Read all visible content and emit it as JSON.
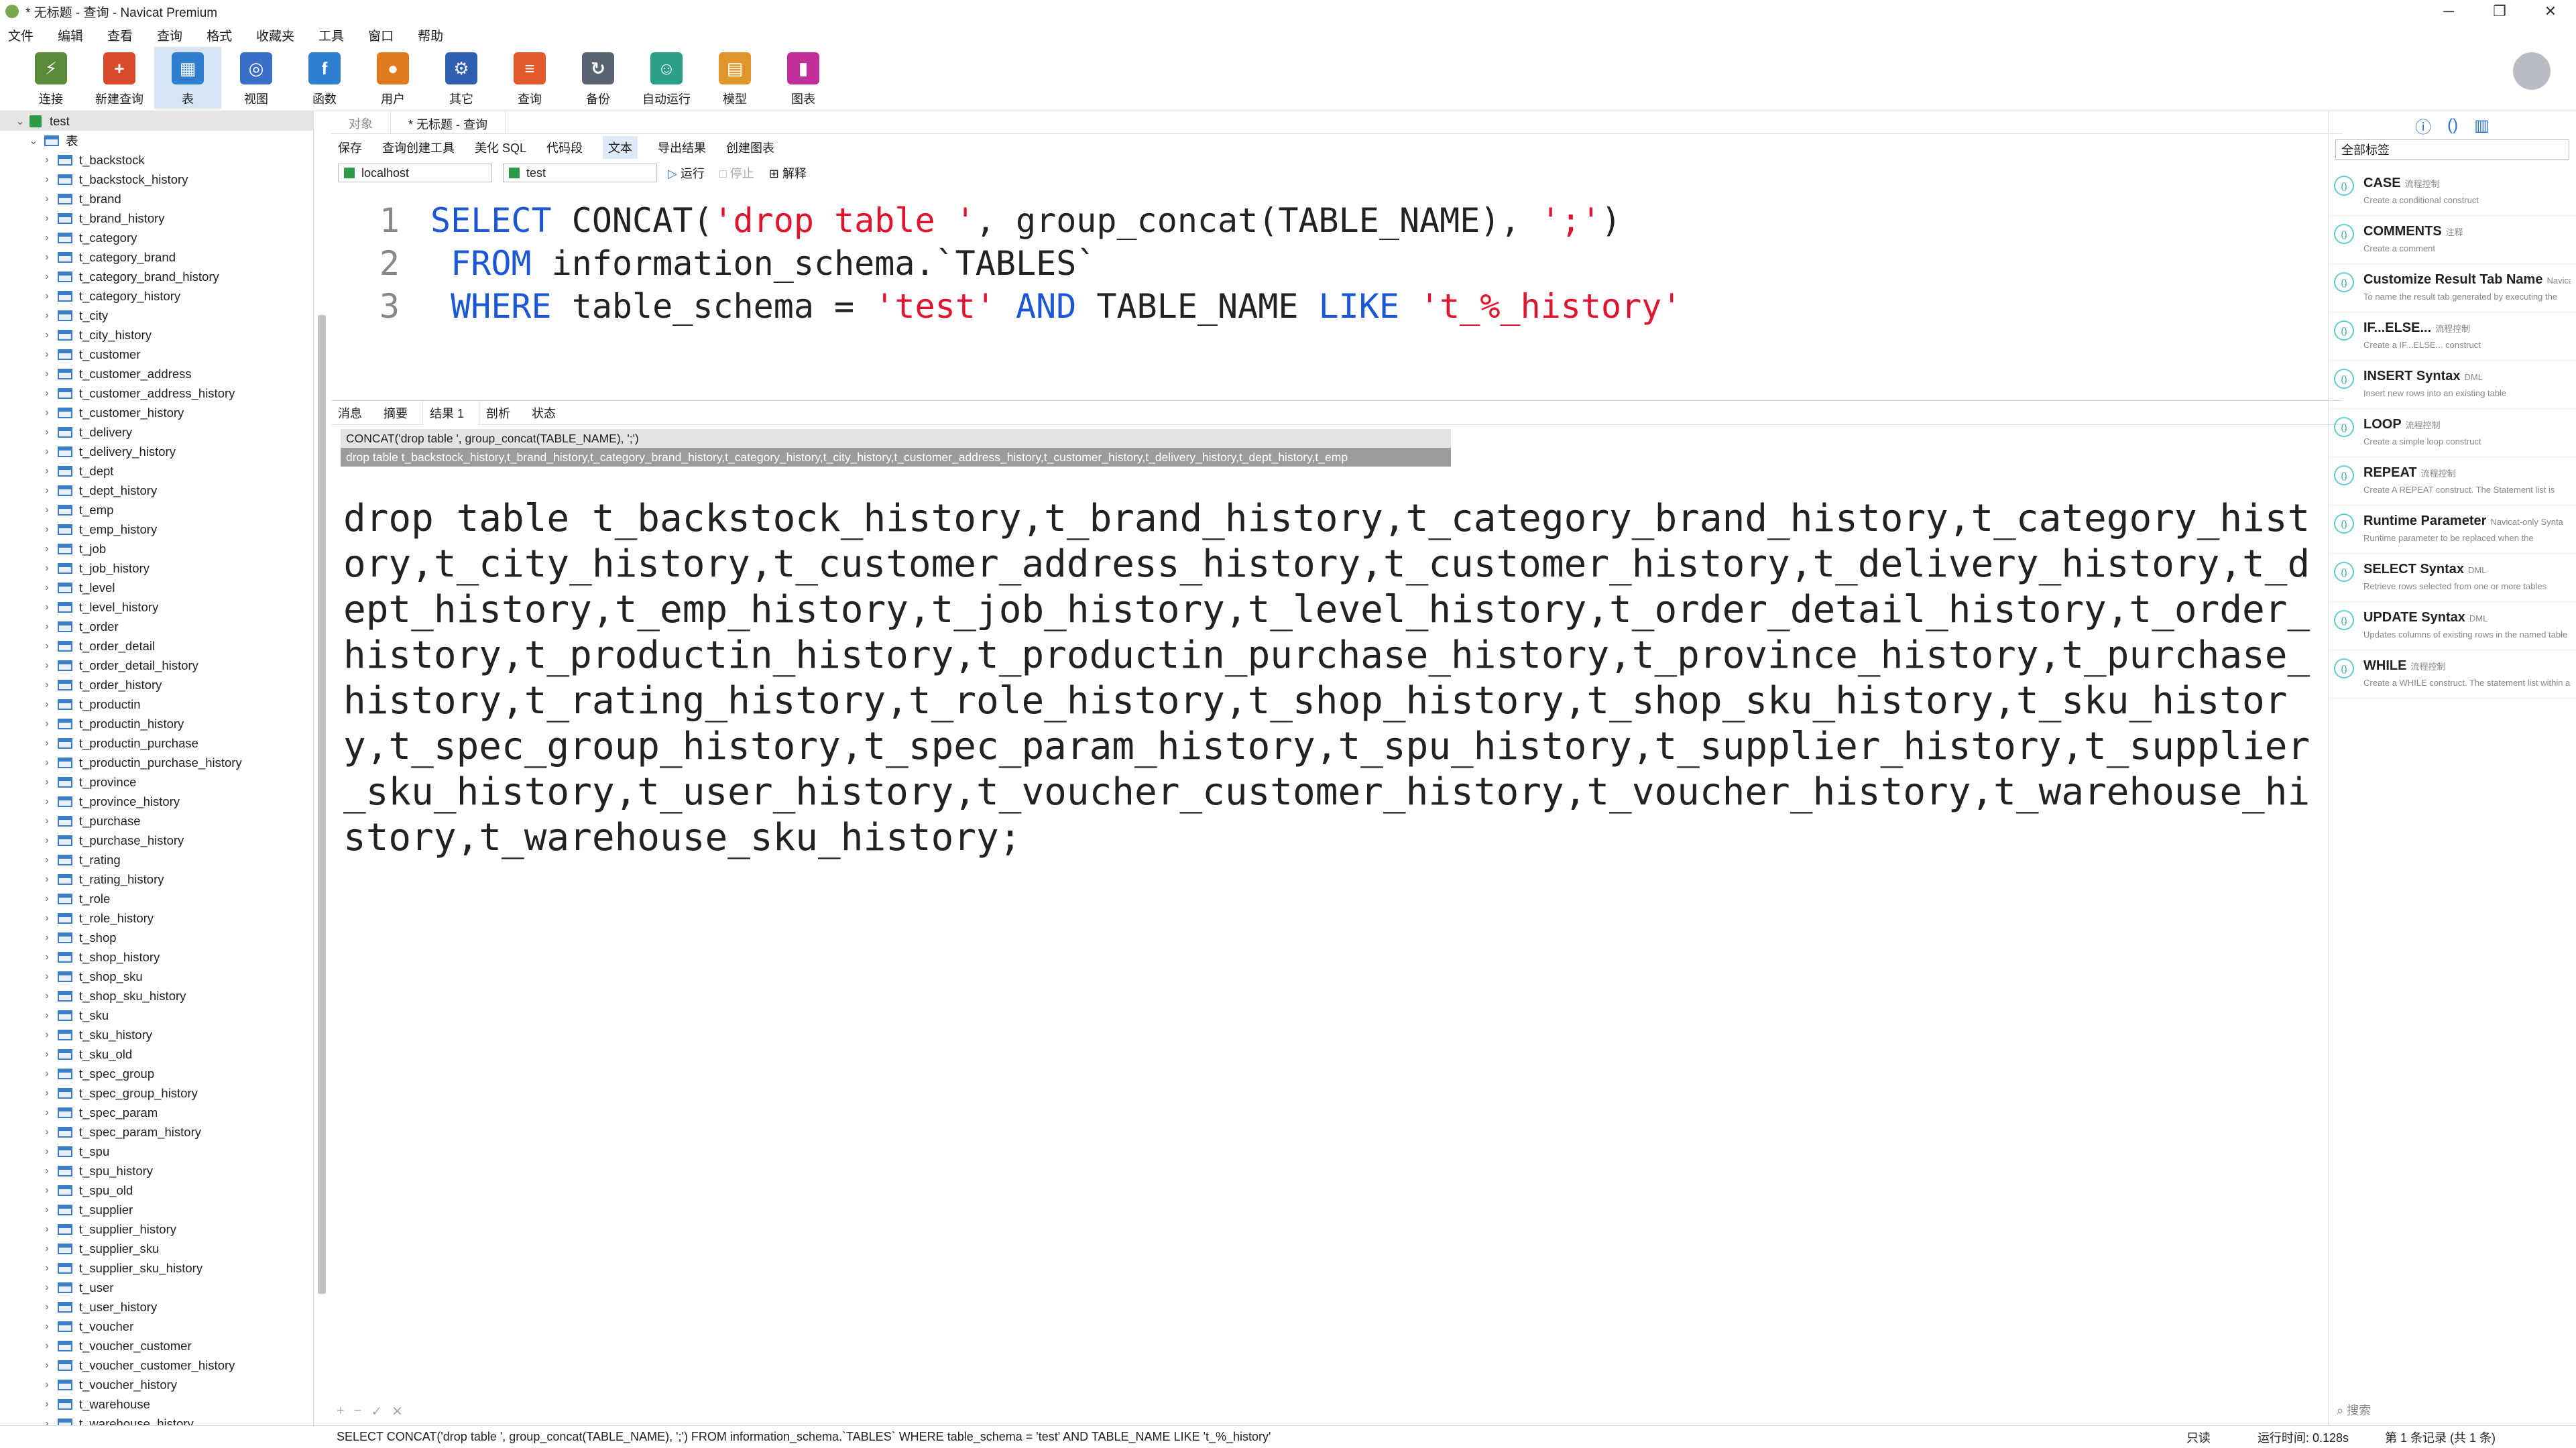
{
  "window": {
    "title": "* 无标题 - 查询 - Navicat Premium"
  },
  "menu": [
    "文件",
    "编辑",
    "查看",
    "查询",
    "格式",
    "收藏夹",
    "工具",
    "窗口",
    "帮助"
  ],
  "toolbar": [
    {
      "label": "连接",
      "color": "#5a8a3a",
      "glyph": "⚡"
    },
    {
      "label": "新建查询",
      "color": "#d94a2b",
      "glyph": "+"
    },
    {
      "label": "表",
      "color": "#2f7fd0",
      "glyph": "▦"
    },
    {
      "label": "视图",
      "color": "#3a6fc8",
      "glyph": "◎"
    },
    {
      "label": "函数",
      "color": "#2f7fd0",
      "glyph": "f"
    },
    {
      "label": "用户",
      "color": "#e07b22",
      "glyph": "●"
    },
    {
      "label": "其它",
      "color": "#2f5fb0",
      "glyph": "⚙"
    },
    {
      "label": "查询",
      "color": "#e05a2b",
      "glyph": "≡"
    },
    {
      "label": "备份",
      "color": "#5a6470",
      "glyph": "↻"
    },
    {
      "label": "自动运行",
      "color": "#2aa08a",
      "glyph": "☺"
    },
    {
      "label": "模型",
      "color": "#e0962b",
      "glyph": "▤"
    },
    {
      "label": "图表",
      "color": "#c02f9a",
      "glyph": "▮"
    }
  ],
  "sidebar": {
    "db": "test",
    "group": "表",
    "tables": [
      "t_backstock",
      "t_backstock_history",
      "t_brand",
      "t_brand_history",
      "t_category",
      "t_category_brand",
      "t_category_brand_history",
      "t_category_history",
      "t_city",
      "t_city_history",
      "t_customer",
      "t_customer_address",
      "t_customer_address_history",
      "t_customer_history",
      "t_delivery",
      "t_delivery_history",
      "t_dept",
      "t_dept_history",
      "t_emp",
      "t_emp_history",
      "t_job",
      "t_job_history",
      "t_level",
      "t_level_history",
      "t_order",
      "t_order_detail",
      "t_order_detail_history",
      "t_order_history",
      "t_productin",
      "t_productin_history",
      "t_productin_purchase",
      "t_productin_purchase_history",
      "t_province",
      "t_province_history",
      "t_purchase",
      "t_purchase_history",
      "t_rating",
      "t_rating_history",
      "t_role",
      "t_role_history",
      "t_shop",
      "t_shop_history",
      "t_shop_sku",
      "t_shop_sku_history",
      "t_sku",
      "t_sku_history",
      "t_sku_old",
      "t_spec_group",
      "t_spec_group_history",
      "t_spec_param",
      "t_spec_param_history",
      "t_spu",
      "t_spu_history",
      "t_spu_old",
      "t_supplier",
      "t_supplier_history",
      "t_supplier_sku",
      "t_supplier_sku_history",
      "t_user",
      "t_user_history",
      "t_voucher",
      "t_voucher_customer",
      "t_voucher_customer_history",
      "t_voucher_history",
      "t_warehouse",
      "t_warehouse_history"
    ]
  },
  "tabs": {
    "objects": "对象",
    "query": "* 无标题 - 查询"
  },
  "querybar": {
    "save": "保存",
    "builder": "查询创建工具",
    "beautify": "美化 SQL",
    "snippet": "代码段",
    "text": "文本",
    "export": "导出结果",
    "chart": "创建图表"
  },
  "conn": {
    "server": "localhost",
    "db": "test",
    "run": "运行",
    "stop": "停止",
    "explain": "解释"
  },
  "editor": {
    "lines": [
      "1",
      "2",
      "3"
    ]
  },
  "resultTabs": [
    "消息",
    "摘要",
    "结果 1",
    "剖析",
    "状态"
  ],
  "grid": {
    "header": "CONCAT('drop table ', group_concat(TABLE_NAME), ';')",
    "row": "drop table t_backstock_history,t_brand_history,t_category_brand_history,t_category_history,t_city_history,t_customer_address_history,t_customer_history,t_delivery_history,t_dept_history,t_emp"
  },
  "result": "drop table t_backstock_history,t_brand_history,t_category_brand_history,t_category_history,t_city_history,t_customer_address_history,t_customer_history,t_delivery_history,t_dept_history,t_emp_history,t_job_history,t_level_history,t_order_detail_history,t_order_history,t_productin_history,t_productin_purchase_history,t_province_history,t_purchase_history,t_rating_history,t_role_history,t_shop_history,t_shop_sku_history,t_sku_history,t_spec_group_history,t_spec_param_history,t_spu_history,t_supplier_history,t_supplier_sku_history,t_user_history,t_voucher_customer_history,t_voucher_history,t_warehouse_history,t_warehouse_sku_history;",
  "snippets": {
    "filter": "全部标签",
    "items": [
      {
        "name": "CASE",
        "tag": "流程控制",
        "desc": "Create a conditional construct"
      },
      {
        "name": "COMMENTS",
        "tag": "注释",
        "desc": "Create a comment"
      },
      {
        "name": "Customize Result Tab Name",
        "tag": "Navicat",
        "desc": "To name the result tab generated by executing the statement."
      },
      {
        "name": "IF...ELSE...",
        "tag": "流程控制",
        "desc": "Create a IF...ELSE... construct"
      },
      {
        "name": "INSERT Syntax",
        "tag": "DML",
        "desc": "Insert new rows into an existing table"
      },
      {
        "name": "LOOP",
        "tag": "流程控制",
        "desc": "Create a simple loop construct"
      },
      {
        "name": "REPEAT",
        "tag": "流程控制",
        "desc": "Create A REPEAT construct. The Statement list is repeated until the search_condition expression is true."
      },
      {
        "name": "Runtime Parameter",
        "tag": "Navicat-only Synta",
        "desc": "Runtime parameter to be replaced when the statements are executed. Navicat by then will pop a dialog for you to input value."
      },
      {
        "name": "SELECT Syntax",
        "tag": "DML",
        "desc": "Retrieve rows selected from one or more tables"
      },
      {
        "name": "UPDATE Syntax",
        "tag": "DML",
        "desc": "Updates columns of existing rows in the named table with new values"
      },
      {
        "name": "WHILE",
        "tag": "流程控制",
        "desc": "Create a WHILE construct. The statement list within a WHILE statement is repeated as long as the search_condition expression is true."
      }
    ],
    "search": "搜索"
  },
  "status": {
    "sql": "SELECT CONCAT('drop table ', group_concat(TABLE_NAME), ';')   FROM information_schema.`TABLES`   WHERE table_schema = 'test' AND TABLE_NAME LIKE 't_%_history'",
    "mode": "只读",
    "time": "运行时间: 0.128s",
    "records": "第 1 条记录 (共 1 条)"
  }
}
